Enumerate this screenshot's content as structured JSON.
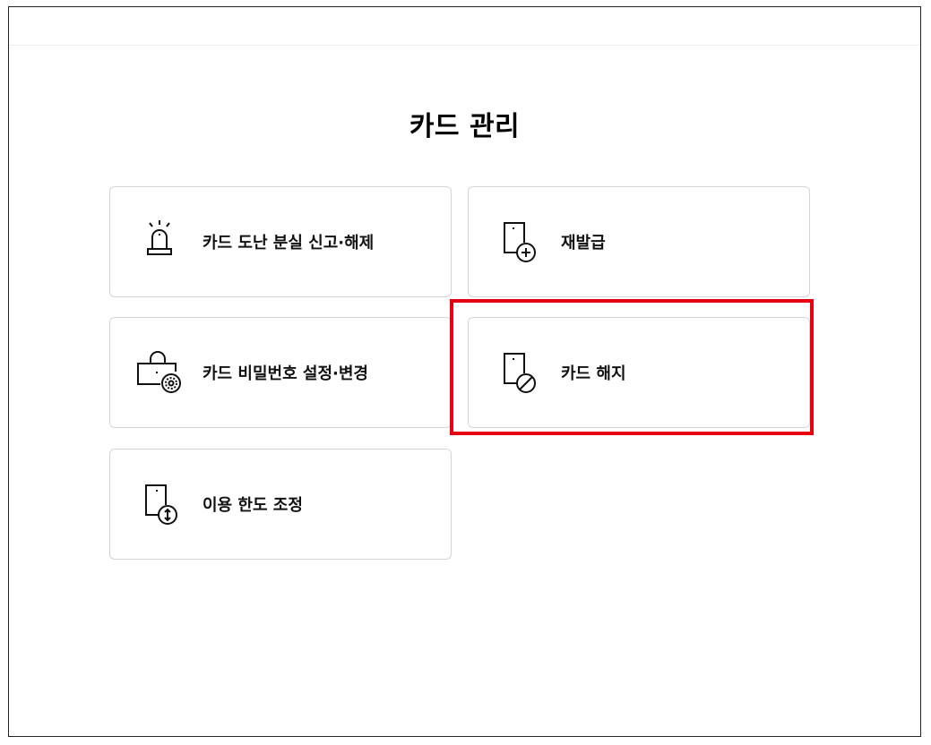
{
  "page": {
    "title": "카드 관리"
  },
  "menu": {
    "items": [
      {
        "label": "카드 도난 분실 신고·해제",
        "icon": "siren-icon"
      },
      {
        "label": "재발급",
        "icon": "card-add-icon"
      },
      {
        "label": "카드 비밀번호 설정·변경",
        "icon": "lock-settings-icon"
      },
      {
        "label": "카드 해지",
        "icon": "card-cancel-icon"
      },
      {
        "label": "이용 한도 조정",
        "icon": "card-limit-icon"
      }
    ]
  },
  "highlight": {
    "target": "카드 해지",
    "color": "#e60012"
  }
}
